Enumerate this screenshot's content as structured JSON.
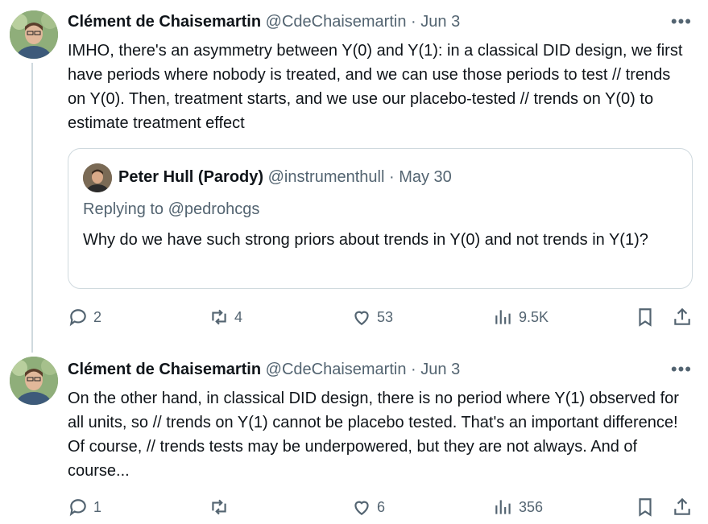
{
  "tweets": [
    {
      "author": "Clément de Chaisemartin",
      "handle": "@CdeChaisemartin",
      "separator": "·",
      "date": "Jun 3",
      "more": "•••",
      "text": "IMHO, there's an asymmetry between Y(0) and Y(1): in a classical DID design, we first have periods where nobody is treated, and we can use those periods to test // trends on Y(0). Then, treatment starts, and we use our placebo-tested // trends on Y(0) to estimate treatment effect",
      "quote": {
        "author": "Peter Hull (Parody)",
        "handle": "@instrumenthull",
        "separator": "·",
        "date": "May 30",
        "replying_to": "Replying to @pedrohcgs",
        "text": "Why do we have such strong priors about trends in Y(0) and not trends in Y(1)?"
      },
      "actions": {
        "replies": "2",
        "retweets": "4",
        "likes": "53",
        "views": "9.5K"
      }
    },
    {
      "author": "Clément de Chaisemartin",
      "handle": "@CdeChaisemartin",
      "separator": "·",
      "date": "Jun 3",
      "more": "•••",
      "text": "On the other hand, in classical DID design, there is no period where Y(1) observed for all units, so // trends on Y(1) cannot be placebo tested. That's an important difference! Of course, // trends tests may be underpowered, but they are not always. And of course...",
      "actions": {
        "replies": "1",
        "retweets": "",
        "likes": "6",
        "views": "356"
      }
    }
  ],
  "icons": {
    "reply": "reply-icon",
    "retweet": "retweet-icon",
    "like": "heart-icon",
    "views": "views-icon",
    "bookmark": "bookmark-icon",
    "share": "share-icon",
    "more": "more-icon"
  },
  "colors": {
    "text": "#0f1419",
    "secondary": "#536471",
    "border": "#cfd9de"
  }
}
